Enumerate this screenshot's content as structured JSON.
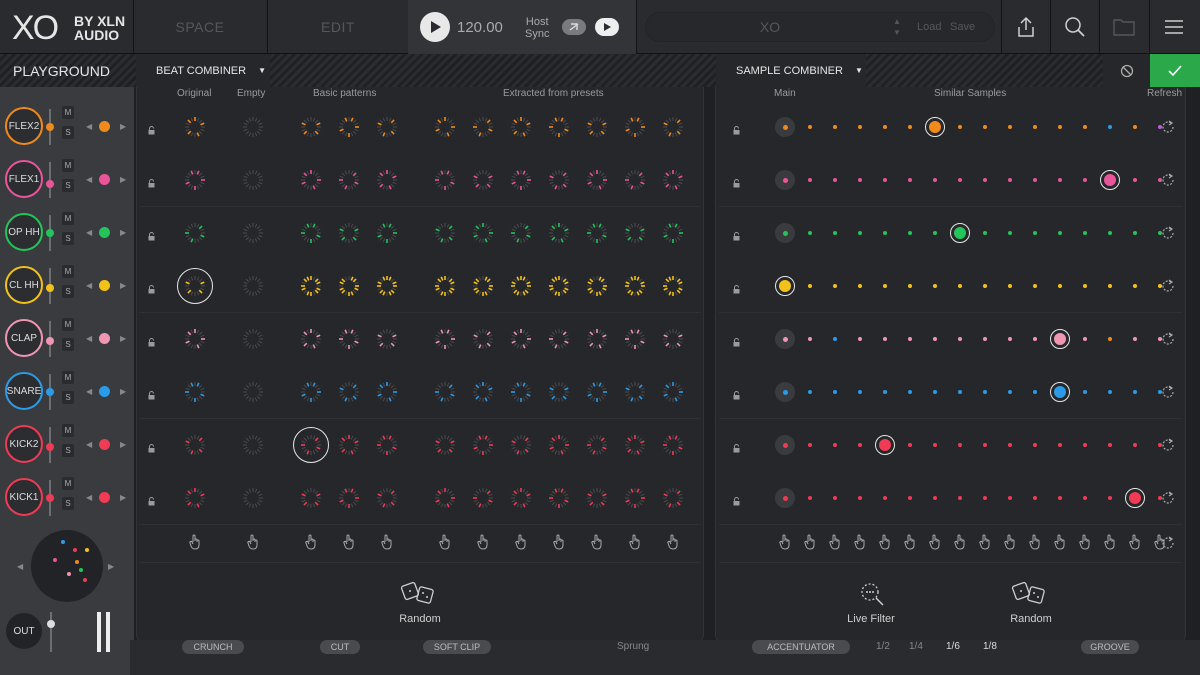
{
  "topbar": {
    "logo_main": "XO",
    "logo_by": "BY XLN",
    "logo_audio": "AUDIO",
    "nav_space": "SPACE",
    "nav_edit": "EDIT",
    "bpm": "120.00",
    "host_sync_line1": "Host",
    "host_sync_line2": "Sync",
    "preset_name": "XO",
    "load_label": "Load",
    "save_label": "Save"
  },
  "header": {
    "playground": "PLAYGROUND",
    "beat_combiner": "BEAT COMBINER",
    "sample_combiner": "SAMPLE COMBINER"
  },
  "beat_combiner": {
    "col_original": "Original",
    "col_empty": "Empty",
    "col_basic": "Basic patterns",
    "col_extracted": "Extracted from presets",
    "random_label": "Random"
  },
  "sample_combiner": {
    "col_main": "Main",
    "col_similar": "Similar Samples",
    "col_refresh": "Refresh",
    "live_filter_label": "Live Filter",
    "random_label": "Random"
  },
  "sidebar": {
    "mute_label": "M",
    "solo_label": "S",
    "out_label": "OUT",
    "slots": [
      {
        "name": "FLEX2",
        "color": "#f08a1c",
        "fader": 0.55
      },
      {
        "name": "FLEX1",
        "color": "#e9559a",
        "fader": 0.45
      },
      {
        "name": "OP HH",
        "color": "#23c45a",
        "fader": 0.55
      },
      {
        "name": "CL HH",
        "color": "#f2c21b",
        "fader": 0.5
      },
      {
        "name": "CLAP",
        "color": "#ef97b2",
        "fader": 0.5
      },
      {
        "name": "SNARE",
        "color": "#2b9be8",
        "fader": 0.55
      },
      {
        "name": "KICK2",
        "color": "#ef3b54",
        "fader": 0.5
      },
      {
        "name": "KICK1",
        "color": "#ef3b54",
        "fader": 0.55
      }
    ]
  },
  "beat_grid": {
    "selected_cols": [
      0,
      0,
      0,
      0,
      0,
      0,
      2,
      0
    ],
    "highlighted_rows": [
      3,
      6
    ]
  },
  "sample_grid": {
    "selected_index": [
      6,
      13,
      7,
      0,
      11,
      11,
      4,
      14
    ],
    "dot_colors_row0": [
      "#f08a1c",
      "#f08a1c",
      "#f08a1c",
      "#f08a1c",
      "#f08a1c",
      "#f08a1c",
      "#f08a1c",
      "#f08a1c",
      "#f08a1c",
      "#f08a1c",
      "#f08a1c",
      "#f08a1c",
      "#2b9be8",
      "#f08a1c",
      "#c158e8"
    ],
    "dot_colors_row4": [
      "#ef97b2",
      "#2b9be8",
      "#ef97b2",
      "#ef97b2",
      "#ef97b2",
      "#ef97b2",
      "#ef97b2",
      "#ef97b2",
      "#ef97b2",
      "#ef97b2",
      "#ef97b2",
      "#ef97b2",
      "#f08a1c",
      "#ef97b2",
      "#ef97b2"
    ]
  },
  "footer": {
    "crunch": "CRUNCH",
    "cut": "CUT",
    "soft_clip": "SOFT CLIP",
    "sprung": "Sprung",
    "accentuator": "ACCENTUATOR",
    "div_half": "1/2",
    "div_quarter": "1/4",
    "div_sixth": "1/6",
    "div_eighth": "1/8",
    "groove": "GROOVE"
  }
}
